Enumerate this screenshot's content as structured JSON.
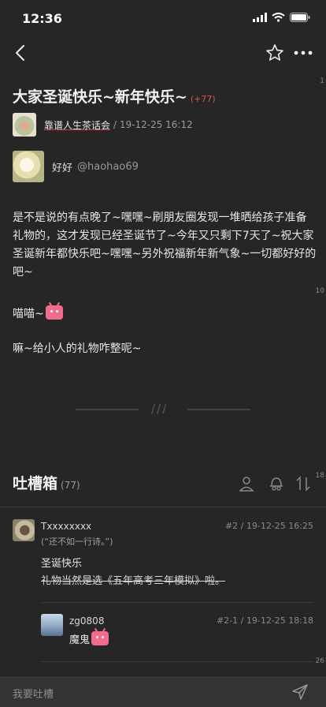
{
  "status_bar": {
    "time": "12:36"
  },
  "page_counters": [
    "1",
    "10",
    "18",
    "26"
  ],
  "post": {
    "title": "大家圣诞快乐~新年快乐~",
    "count_badge": "(+77)",
    "group_name": "靠谱人生茶话会",
    "meta_date": "/ 19-12-25 16:12",
    "author_name": "好好",
    "author_handle": "@haohao69",
    "paragraphs": [
      "是不是说的有点晚了~嘿嘿~刷朋友圈发现一堆晒给孩子准备礼物的，这才发现已经圣诞节了~今年又只剩下7天了~祝大家圣诞新年都快乐吧~嘿嘿~另外祝福新年新气象~一切都好好的吧~",
      "喵喵~",
      "嘛~给小人的礼物咋整呢~"
    ],
    "divider_mark": "///"
  },
  "comments_section": {
    "title": "吐槽箱",
    "count": "(77)",
    "icons": [
      "person-icon",
      "hat-icon",
      "sort-icon"
    ]
  },
  "comments": [
    {
      "name": "Txxxxxxxx",
      "meta": "#2 / 19-12-25 16:25",
      "signature": "(“还不如一行诗。”)",
      "line1": "圣诞快乐",
      "line2_strike": "礼物当然是选《五年高考三年模拟》啦。"
    },
    {
      "name": "zg0808",
      "meta": "#2-1 / 19-12-25 18:18",
      "text": "魔鬼"
    }
  ],
  "input_bar": {
    "placeholder": "我要吐槽"
  },
  "colors": {
    "background": "#262626",
    "accent": "#e05050",
    "emoji_pink": "#f26d8d"
  }
}
